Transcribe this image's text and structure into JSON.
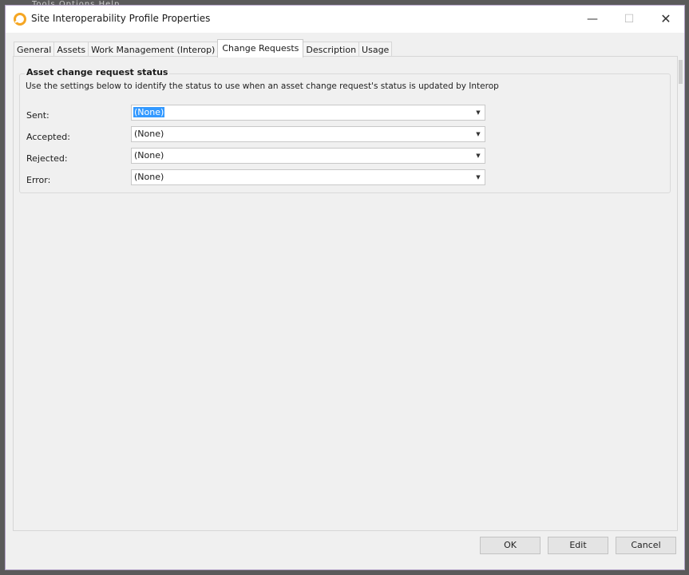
{
  "backdrop_menu": "Tools Options Help",
  "window": {
    "title": "Site Interoperability Profile Properties",
    "controls": {
      "minimize": "—",
      "maximize": "☐",
      "close": "✕"
    }
  },
  "tabs": [
    {
      "label": "General"
    },
    {
      "label": "Assets"
    },
    {
      "label": "Work Management (Interop)"
    },
    {
      "label": "Change Requests",
      "active": true
    },
    {
      "label": "Description"
    },
    {
      "label": "Usage"
    }
  ],
  "group": {
    "title": "Asset change request status",
    "description": "Use the settings below to identify the status to use when an asset change request's status  is updated by Interop",
    "rows": [
      {
        "label": "Sent:",
        "value": "(None)"
      },
      {
        "label": "Accepted:",
        "value": "(None)"
      },
      {
        "label": "Rejected:",
        "value": "(None)"
      },
      {
        "label": "Error:",
        "value": "(None)"
      }
    ],
    "dropdown_arrow": "▼"
  },
  "buttons": {
    "ok": "OK",
    "edit": "Edit",
    "cancel": "Cancel"
  },
  "colors": {
    "selection": "#3399ff",
    "app_icon": "#f5a623"
  }
}
